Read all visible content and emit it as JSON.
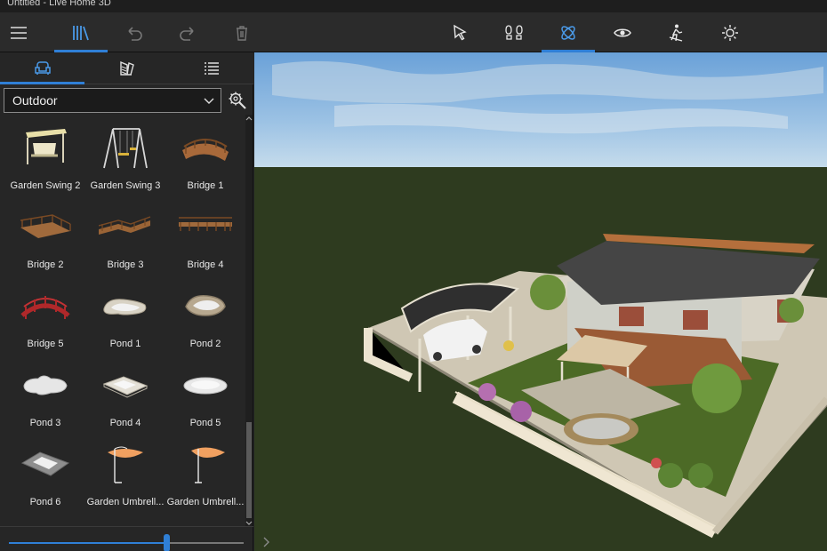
{
  "window": {
    "title": "Untitled - Live Home 3D"
  },
  "toolbar": {
    "left_buttons": [
      {
        "name": "menu-button",
        "icon": "hamburger-icon",
        "active": false
      },
      {
        "name": "library-button",
        "icon": "library-icon",
        "active": true
      },
      {
        "name": "undo-button",
        "icon": "undo-icon",
        "active": false
      },
      {
        "name": "redo-button",
        "icon": "redo-icon",
        "active": false
      },
      {
        "name": "delete-button",
        "icon": "trash-icon",
        "active": false
      }
    ],
    "center_buttons": [
      {
        "name": "select-tool-button",
        "icon": "cursor-icon",
        "active": false
      },
      {
        "name": "walk-mode-button",
        "icon": "footprints-icon",
        "active": false
      },
      {
        "name": "orbit-mode-button",
        "icon": "orbit-icon",
        "active": true
      },
      {
        "name": "view-button",
        "icon": "eye-icon",
        "active": false
      },
      {
        "name": "stroll-button",
        "icon": "walker-icon",
        "active": false
      },
      {
        "name": "lighting-button",
        "icon": "sun-icon",
        "active": false
      }
    ],
    "accent_color": "#2f7fd6"
  },
  "panel": {
    "tabs": [
      {
        "name": "tab-objects",
        "icon": "armchair-icon",
        "active": true
      },
      {
        "name": "tab-materials",
        "icon": "palette-icon",
        "active": false
      },
      {
        "name": "tab-list",
        "icon": "list-icon",
        "active": false
      }
    ],
    "category": {
      "value": "Outdoor"
    },
    "items": [
      {
        "label": "Garden Swing 2",
        "icon": "garden-swing-icon"
      },
      {
        "label": "Garden Swing 3",
        "icon": "swing-frame-icon"
      },
      {
        "label": "Bridge 1",
        "icon": "bridge-icon"
      },
      {
        "label": "Bridge 2",
        "icon": "deck-bridge-icon"
      },
      {
        "label": "Bridge 3",
        "icon": "deck-bridge-icon"
      },
      {
        "label": "Bridge 4",
        "icon": "deck-bridge-icon"
      },
      {
        "label": "Bridge 5",
        "icon": "red-bridge-icon"
      },
      {
        "label": "Pond 1",
        "icon": "pond-icon"
      },
      {
        "label": "Pond 2",
        "icon": "pond-icon"
      },
      {
        "label": "Pond 3",
        "icon": "pond-icon"
      },
      {
        "label": "Pond 4",
        "icon": "pond-icon"
      },
      {
        "label": "Pond 5",
        "icon": "pond-icon"
      },
      {
        "label": "Pond 6",
        "icon": "pond-icon"
      },
      {
        "label": "Garden Umbrell...",
        "icon": "umbrella-icon"
      },
      {
        "label": "Garden Umbrell...",
        "icon": "umbrella-icon"
      }
    ],
    "size_slider": {
      "value_fraction": 0.67
    }
  }
}
